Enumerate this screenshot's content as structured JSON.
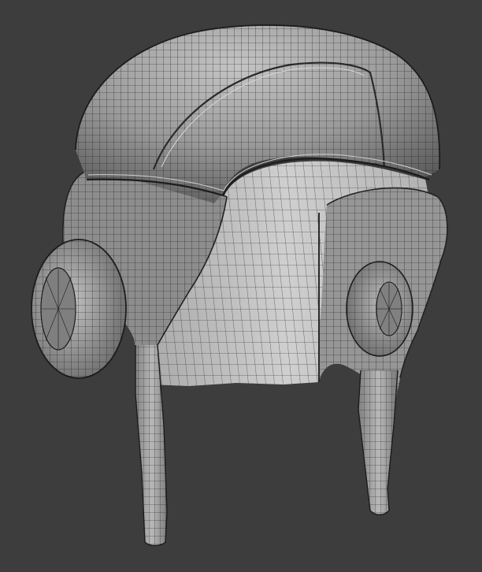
{
  "scene": {
    "subject": "helmet-wireframe-mesh",
    "background_color": "#3d3d3d",
    "surface_color_light": "#b4b4b4",
    "surface_color_mid": "#8f8f8f",
    "surface_color_dark": "#5e5e5e",
    "wire_color": "#1a1a1a",
    "inner_shell_color": "#c8c8c8"
  }
}
